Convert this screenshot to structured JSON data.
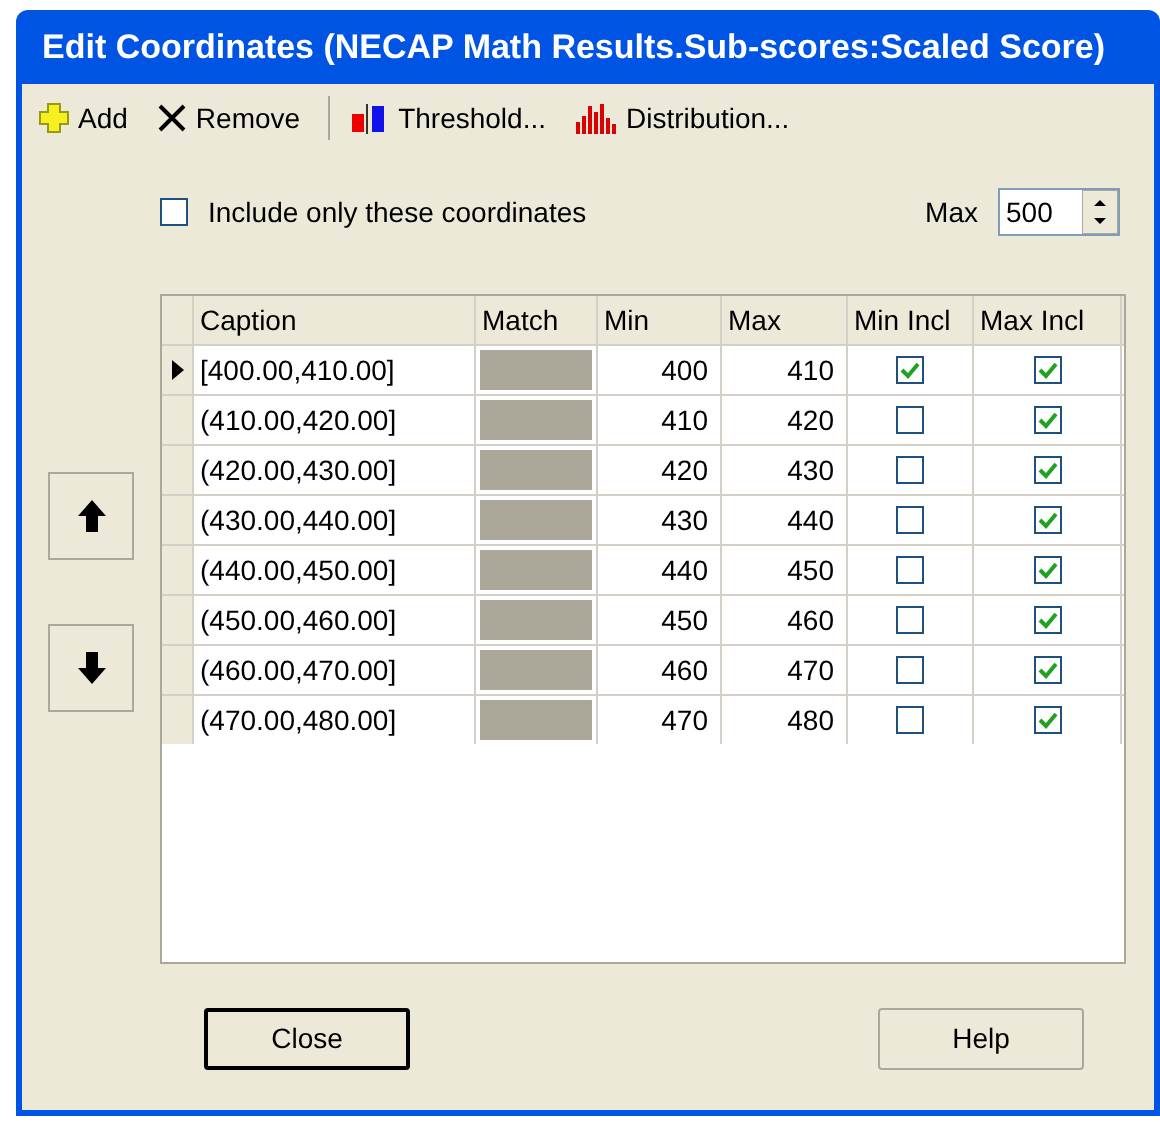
{
  "window": {
    "title": "Edit Coordinates (NECAP Math Results.Sub-scores:Scaled Score)"
  },
  "toolbar": [
    {
      "kind": "add",
      "label": "Add"
    },
    {
      "kind": "remove",
      "label": "Remove"
    },
    {
      "kind": "threshold",
      "label": "Threshold..."
    },
    {
      "kind": "distribution",
      "label": "Distribution..."
    }
  ],
  "include_only": {
    "label": "Include only these coordinates",
    "checked": false
  },
  "max": {
    "label": "Max",
    "value": "500"
  },
  "table": {
    "columns": [
      "Caption",
      "Match",
      "Min",
      "Max",
      "Min Incl",
      "Max Incl"
    ],
    "rows": [
      {
        "caption": "[400.00,410.00]",
        "min": "400",
        "max": "410",
        "min_incl": true,
        "max_incl": true,
        "selected": true
      },
      {
        "caption": "(410.00,420.00]",
        "min": "410",
        "max": "420",
        "min_incl": false,
        "max_incl": true,
        "selected": false
      },
      {
        "caption": "(420.00,430.00]",
        "min": "420",
        "max": "430",
        "min_incl": false,
        "max_incl": true,
        "selected": false
      },
      {
        "caption": "(430.00,440.00]",
        "min": "430",
        "max": "440",
        "min_incl": false,
        "max_incl": true,
        "selected": false
      },
      {
        "caption": "(440.00,450.00]",
        "min": "440",
        "max": "450",
        "min_incl": false,
        "max_incl": true,
        "selected": false
      },
      {
        "caption": "(450.00,460.00]",
        "min": "450",
        "max": "460",
        "min_incl": false,
        "max_incl": true,
        "selected": false
      },
      {
        "caption": "(460.00,470.00]",
        "min": "460",
        "max": "470",
        "min_incl": false,
        "max_incl": true,
        "selected": false
      },
      {
        "caption": "(470.00,480.00]",
        "min": "470",
        "max": "480",
        "min_incl": false,
        "max_incl": true,
        "selected": false
      }
    ]
  },
  "buttons": [
    {
      "label": "Close",
      "default": true
    },
    {
      "label": "Help",
      "default": false
    }
  ]
}
